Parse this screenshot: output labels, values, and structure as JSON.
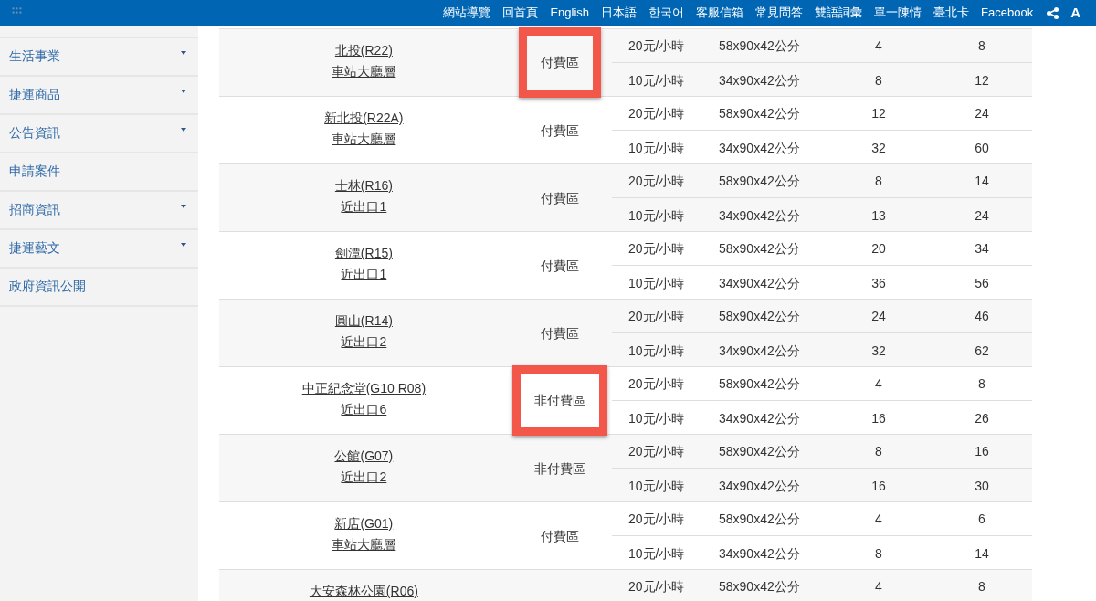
{
  "top_bar": {
    "links": [
      "網站導覽",
      "回首頁",
      "English",
      "日本語",
      "한국어",
      "客服信箱",
      "常見問答",
      "雙語詞彙",
      "單一陳情",
      "臺北卡",
      "Facebook"
    ],
    "font_size_button": "A"
  },
  "sidebar": {
    "items": [
      {
        "label": "生活事業",
        "has_submenu": true
      },
      {
        "label": "捷運商品",
        "has_submenu": true
      },
      {
        "label": "公告資訊",
        "has_submenu": true
      },
      {
        "label": "申請案件",
        "has_submenu": false
      },
      {
        "label": "招商資訊",
        "has_submenu": true
      },
      {
        "label": "捷運藝文",
        "has_submenu": true
      },
      {
        "label": "政府資訊公開",
        "has_submenu": false
      }
    ]
  },
  "table": {
    "groups": [
      {
        "station": "北投(R22)",
        "location": "車站大廳層",
        "area": "付費區",
        "highlighted": true,
        "rows": [
          {
            "cells": [
              "20元/小時",
              "58x90x42公分",
              "4",
              "8"
            ]
          },
          {
            "cells": [
              "10元/小時",
              "34x90x42公分",
              "8",
              "12"
            ]
          }
        ]
      },
      {
        "station": "新北投(R22A)",
        "location": "車站大廳層",
        "area": "付費區",
        "highlighted": false,
        "rows": [
          {
            "cells": [
              "20元/小時",
              "58x90x42公分",
              "12",
              "24"
            ]
          },
          {
            "cells": [
              "10元/小時",
              "34x90x42公分",
              "32",
              "60"
            ]
          }
        ]
      },
      {
        "station": "士林(R16)",
        "location": "近出口1",
        "area": "付費區",
        "highlighted": false,
        "rows": [
          {
            "cells": [
              "20元/小時",
              "58x90x42公分",
              "8",
              "14"
            ]
          },
          {
            "cells": [
              "10元/小時",
              "34x90x42公分",
              "13",
              "24"
            ]
          }
        ]
      },
      {
        "station": "劍潭(R15)",
        "location": "近出口1",
        "area": "付費區",
        "highlighted": false,
        "rows": [
          {
            "cells": [
              "20元/小時",
              "58x90x42公分",
              "20",
              "34"
            ]
          },
          {
            "cells": [
              "10元/小時",
              "34x90x42公分",
              "36",
              "56"
            ]
          }
        ]
      },
      {
        "station": "圓山(R14)",
        "location": "近出口2",
        "area": "付費區",
        "highlighted": false,
        "rows": [
          {
            "cells": [
              "20元/小時",
              "58x90x42公分",
              "24",
              "46"
            ]
          },
          {
            "cells": [
              "10元/小時",
              "34x90x42公分",
              "32",
              "62"
            ]
          }
        ]
      },
      {
        "station": "中正紀念堂(G10 R08)",
        "location": "近出口6",
        "area": "非付費區",
        "highlighted": true,
        "rows": [
          {
            "cells": [
              "20元/小時",
              "58x90x42公分",
              "4",
              "8"
            ]
          },
          {
            "cells": [
              "10元/小時",
              "34x90x42公分",
              "16",
              "26"
            ]
          }
        ]
      },
      {
        "station": "公館(G07)",
        "location": "近出口2",
        "area": "非付費區",
        "highlighted": false,
        "rows": [
          {
            "cells": [
              "20元/小時",
              "58x90x42公分",
              "8",
              "16"
            ]
          },
          {
            "cells": [
              "10元/小時",
              "34x90x42公分",
              "16",
              "30"
            ]
          }
        ]
      },
      {
        "station": "新店(G01)",
        "location": "車站大廳層",
        "area": "付費區",
        "highlighted": false,
        "rows": [
          {
            "cells": [
              "20元/小時",
              "58x90x42公分",
              "4",
              "6"
            ]
          },
          {
            "cells": [
              "10元/小時",
              "34x90x42公分",
              "8",
              "14"
            ]
          }
        ]
      },
      {
        "station": "大安森林公園(R06)",
        "highlighted": false,
        "rows": [
          {
            "cells": [
              "20元/小時",
              "58x90x42公分",
              "4",
              "8"
            ]
          }
        ]
      }
    ]
  }
}
